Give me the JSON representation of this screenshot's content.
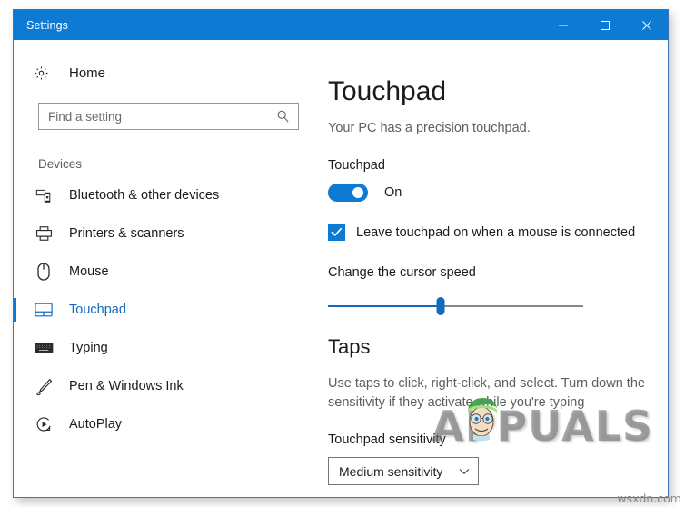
{
  "window": {
    "title": "Settings",
    "accent_color": "#0d7bd4",
    "controls": {
      "minimize": "minimize-button",
      "maximize": "maximize-button",
      "close": "close-button"
    }
  },
  "sidebar": {
    "home_label": "Home",
    "home_icon": "gear-icon",
    "search": {
      "placeholder": "Find a setting",
      "value": "",
      "icon": "search-icon"
    },
    "category": "Devices",
    "items": [
      {
        "label": "Bluetooth & other devices",
        "icon": "devices-icon",
        "selected": false
      },
      {
        "label": "Printers & scanners",
        "icon": "printer-icon",
        "selected": false
      },
      {
        "label": "Mouse",
        "icon": "mouse-icon",
        "selected": false
      },
      {
        "label": "Touchpad",
        "icon": "touchpad-icon",
        "selected": true
      },
      {
        "label": "Typing",
        "icon": "keyboard-icon",
        "selected": false
      },
      {
        "label": "Pen & Windows Ink",
        "icon": "pen-icon",
        "selected": false
      },
      {
        "label": "AutoPlay",
        "icon": "autoplay-icon",
        "selected": false
      }
    ]
  },
  "main": {
    "title": "Touchpad",
    "subtitle": "Your PC has a precision touchpad.",
    "touchpad_section_label": "Touchpad",
    "toggle": {
      "state_label": "On",
      "checked": true
    },
    "checkbox": {
      "label": "Leave touchpad on when a mouse is connected",
      "checked": true
    },
    "slider": {
      "label": "Change the cursor speed",
      "percent": 44
    },
    "taps": {
      "heading": "Taps",
      "description": "Use taps to click, right-click, and select. Turn down the sensitivity if they activate while you're typing",
      "sensitivity_label": "Touchpad sensitivity",
      "sensitivity_value": "Medium sensitivity",
      "sensitivity_chevron": "chevron-down-icon"
    }
  },
  "watermark": {
    "brand": "APPUALS",
    "site": "wsxdn.com"
  }
}
